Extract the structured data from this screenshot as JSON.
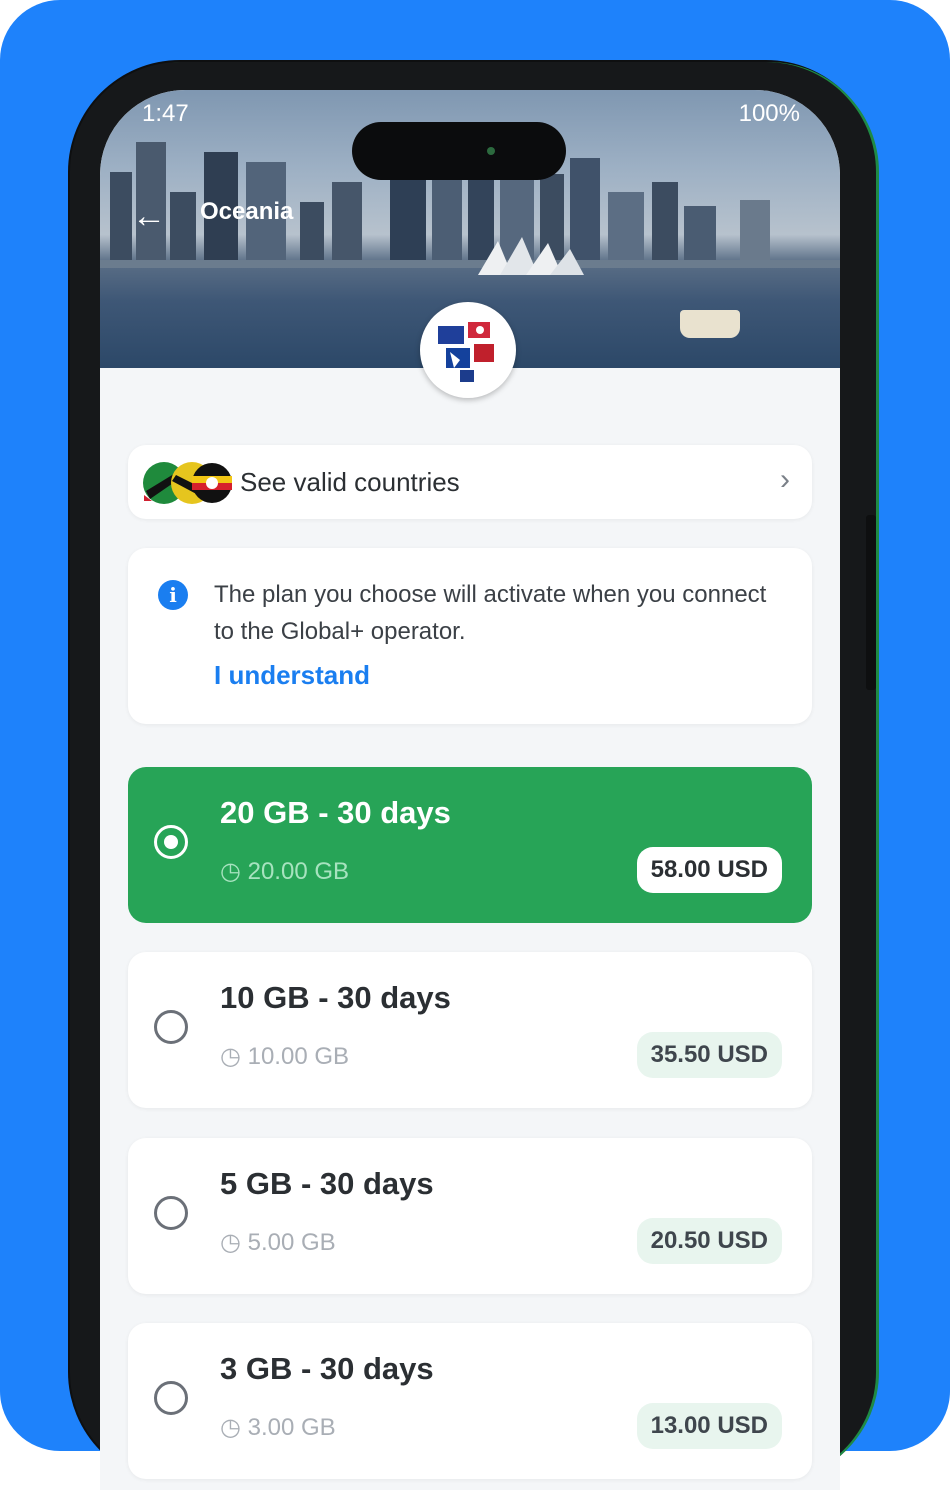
{
  "status_bar": {
    "time": "1:47",
    "right": "100%"
  },
  "header": {
    "title": "Oceania"
  },
  "countries_link": {
    "label": "See valid countries"
  },
  "notice": {
    "text": "The plan you choose will activate when you connect to the Global+ operator.",
    "action": "I understand"
  },
  "plans": [
    {
      "title": "20 GB - 30 days",
      "data": "20.00 GB",
      "price": "58.00 USD",
      "selected": true
    },
    {
      "title": "10 GB - 30 days",
      "data": "10.00 GB",
      "price": "35.50 USD",
      "selected": false
    },
    {
      "title": "5 GB - 30 days",
      "data": "5.00 GB",
      "price": "20.50 USD",
      "selected": false
    },
    {
      "title": "3 GB - 30 days",
      "data": "3.00 GB",
      "price": "13.00 USD",
      "selected": false
    }
  ],
  "colors": {
    "background": "#1e82fb",
    "selected_plan": "#27a457",
    "link": "#1a7ef0"
  },
  "icons": [
    "back-arrow-icon",
    "info-icon",
    "chevron-right-icon",
    "clock-icon",
    "radio-icon"
  ]
}
